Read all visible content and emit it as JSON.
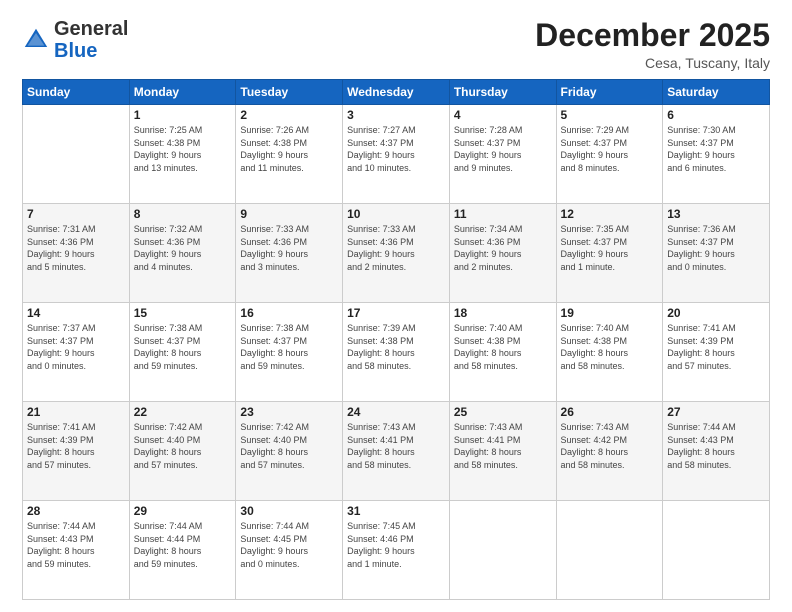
{
  "header": {
    "logo": {
      "general": "General",
      "blue": "Blue"
    },
    "title": "December 2025",
    "location": "Cesa, Tuscany, Italy"
  },
  "days_of_week": [
    "Sunday",
    "Monday",
    "Tuesday",
    "Wednesday",
    "Thursday",
    "Friday",
    "Saturday"
  ],
  "weeks": [
    [
      {
        "day": "",
        "info": ""
      },
      {
        "day": "1",
        "info": "Sunrise: 7:25 AM\nSunset: 4:38 PM\nDaylight: 9 hours\nand 13 minutes."
      },
      {
        "day": "2",
        "info": "Sunrise: 7:26 AM\nSunset: 4:38 PM\nDaylight: 9 hours\nand 11 minutes."
      },
      {
        "day": "3",
        "info": "Sunrise: 7:27 AM\nSunset: 4:37 PM\nDaylight: 9 hours\nand 10 minutes."
      },
      {
        "day": "4",
        "info": "Sunrise: 7:28 AM\nSunset: 4:37 PM\nDaylight: 9 hours\nand 9 minutes."
      },
      {
        "day": "5",
        "info": "Sunrise: 7:29 AM\nSunset: 4:37 PM\nDaylight: 9 hours\nand 8 minutes."
      },
      {
        "day": "6",
        "info": "Sunrise: 7:30 AM\nSunset: 4:37 PM\nDaylight: 9 hours\nand 6 minutes."
      }
    ],
    [
      {
        "day": "7",
        "info": "Sunrise: 7:31 AM\nSunset: 4:36 PM\nDaylight: 9 hours\nand 5 minutes."
      },
      {
        "day": "8",
        "info": "Sunrise: 7:32 AM\nSunset: 4:36 PM\nDaylight: 9 hours\nand 4 minutes."
      },
      {
        "day": "9",
        "info": "Sunrise: 7:33 AM\nSunset: 4:36 PM\nDaylight: 9 hours\nand 3 minutes."
      },
      {
        "day": "10",
        "info": "Sunrise: 7:33 AM\nSunset: 4:36 PM\nDaylight: 9 hours\nand 2 minutes."
      },
      {
        "day": "11",
        "info": "Sunrise: 7:34 AM\nSunset: 4:36 PM\nDaylight: 9 hours\nand 2 minutes."
      },
      {
        "day": "12",
        "info": "Sunrise: 7:35 AM\nSunset: 4:37 PM\nDaylight: 9 hours\nand 1 minute."
      },
      {
        "day": "13",
        "info": "Sunrise: 7:36 AM\nSunset: 4:37 PM\nDaylight: 9 hours\nand 0 minutes."
      }
    ],
    [
      {
        "day": "14",
        "info": "Sunrise: 7:37 AM\nSunset: 4:37 PM\nDaylight: 9 hours\nand 0 minutes."
      },
      {
        "day": "15",
        "info": "Sunrise: 7:38 AM\nSunset: 4:37 PM\nDaylight: 8 hours\nand 59 minutes."
      },
      {
        "day": "16",
        "info": "Sunrise: 7:38 AM\nSunset: 4:37 PM\nDaylight: 8 hours\nand 59 minutes."
      },
      {
        "day": "17",
        "info": "Sunrise: 7:39 AM\nSunset: 4:38 PM\nDaylight: 8 hours\nand 58 minutes."
      },
      {
        "day": "18",
        "info": "Sunrise: 7:40 AM\nSunset: 4:38 PM\nDaylight: 8 hours\nand 58 minutes."
      },
      {
        "day": "19",
        "info": "Sunrise: 7:40 AM\nSunset: 4:38 PM\nDaylight: 8 hours\nand 58 minutes."
      },
      {
        "day": "20",
        "info": "Sunrise: 7:41 AM\nSunset: 4:39 PM\nDaylight: 8 hours\nand 57 minutes."
      }
    ],
    [
      {
        "day": "21",
        "info": "Sunrise: 7:41 AM\nSunset: 4:39 PM\nDaylight: 8 hours\nand 57 minutes."
      },
      {
        "day": "22",
        "info": "Sunrise: 7:42 AM\nSunset: 4:40 PM\nDaylight: 8 hours\nand 57 minutes."
      },
      {
        "day": "23",
        "info": "Sunrise: 7:42 AM\nSunset: 4:40 PM\nDaylight: 8 hours\nand 57 minutes."
      },
      {
        "day": "24",
        "info": "Sunrise: 7:43 AM\nSunset: 4:41 PM\nDaylight: 8 hours\nand 58 minutes."
      },
      {
        "day": "25",
        "info": "Sunrise: 7:43 AM\nSunset: 4:41 PM\nDaylight: 8 hours\nand 58 minutes."
      },
      {
        "day": "26",
        "info": "Sunrise: 7:43 AM\nSunset: 4:42 PM\nDaylight: 8 hours\nand 58 minutes."
      },
      {
        "day": "27",
        "info": "Sunrise: 7:44 AM\nSunset: 4:43 PM\nDaylight: 8 hours\nand 58 minutes."
      }
    ],
    [
      {
        "day": "28",
        "info": "Sunrise: 7:44 AM\nSunset: 4:43 PM\nDaylight: 8 hours\nand 59 minutes."
      },
      {
        "day": "29",
        "info": "Sunrise: 7:44 AM\nSunset: 4:44 PM\nDaylight: 8 hours\nand 59 minutes."
      },
      {
        "day": "30",
        "info": "Sunrise: 7:44 AM\nSunset: 4:45 PM\nDaylight: 9 hours\nand 0 minutes."
      },
      {
        "day": "31",
        "info": "Sunrise: 7:45 AM\nSunset: 4:46 PM\nDaylight: 9 hours\nand 1 minute."
      },
      {
        "day": "",
        "info": ""
      },
      {
        "day": "",
        "info": ""
      },
      {
        "day": "",
        "info": ""
      }
    ]
  ]
}
